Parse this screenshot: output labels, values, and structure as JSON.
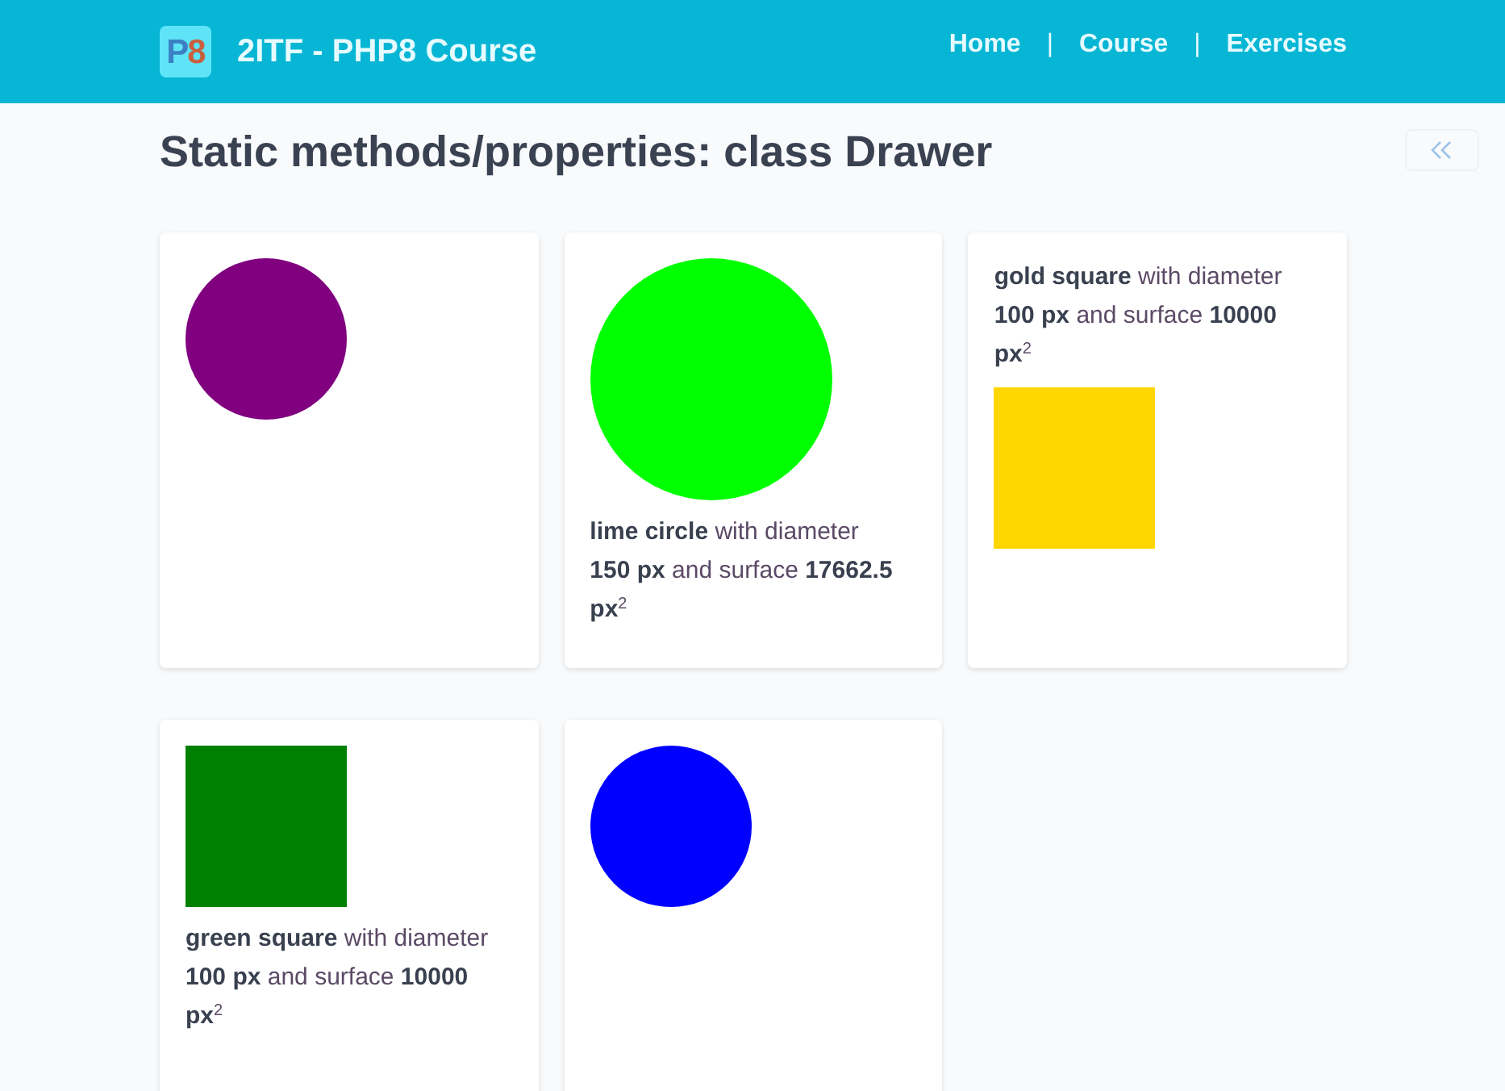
{
  "header": {
    "logo": {
      "parts": [
        {
          "text": "P",
          "color": "#3b7fc4"
        },
        {
          "text": "8",
          "color": "#c8603f"
        }
      ]
    },
    "title": "2ITF - PHP8 Course",
    "nav": [
      {
        "kind": "link",
        "text": "Home"
      },
      {
        "kind": "separator",
        "text": "|"
      },
      {
        "kind": "link",
        "text": "Course"
      },
      {
        "kind": "separator",
        "text": "|"
      },
      {
        "kind": "link",
        "text": "Exercises"
      }
    ]
  },
  "page_title": "Static methods/properties: class Drawer",
  "cards": [
    {
      "items": [
        {
          "kind": "circle",
          "color": "#800080"
        }
      ]
    },
    {
      "items": [
        {
          "kind": "large_circle",
          "color": "#00ff00"
        },
        {
          "kind": "caption",
          "text": "**lime circle** with diameter **150 px** and surface **17662.5 px**$^{2}$"
        }
      ]
    },
    {
      "items": [
        {
          "kind": "caption",
          "text": "**gold square** with diameter **100 px** and surface **10000 px**$^{2}$"
        },
        {
          "kind": "square",
          "color": "#ffd700"
        }
      ]
    },
    {
      "items": [
        {
          "kind": "square",
          "color": "#008000"
        },
        {
          "kind": "caption",
          "text": "**green square** with diameter **100 px** and surface **10000 px**$^{2}$"
        }
      ]
    },
    {
      "items": [
        {
          "kind": "circle",
          "color": "#0000ff"
        }
      ]
    }
  ]
}
